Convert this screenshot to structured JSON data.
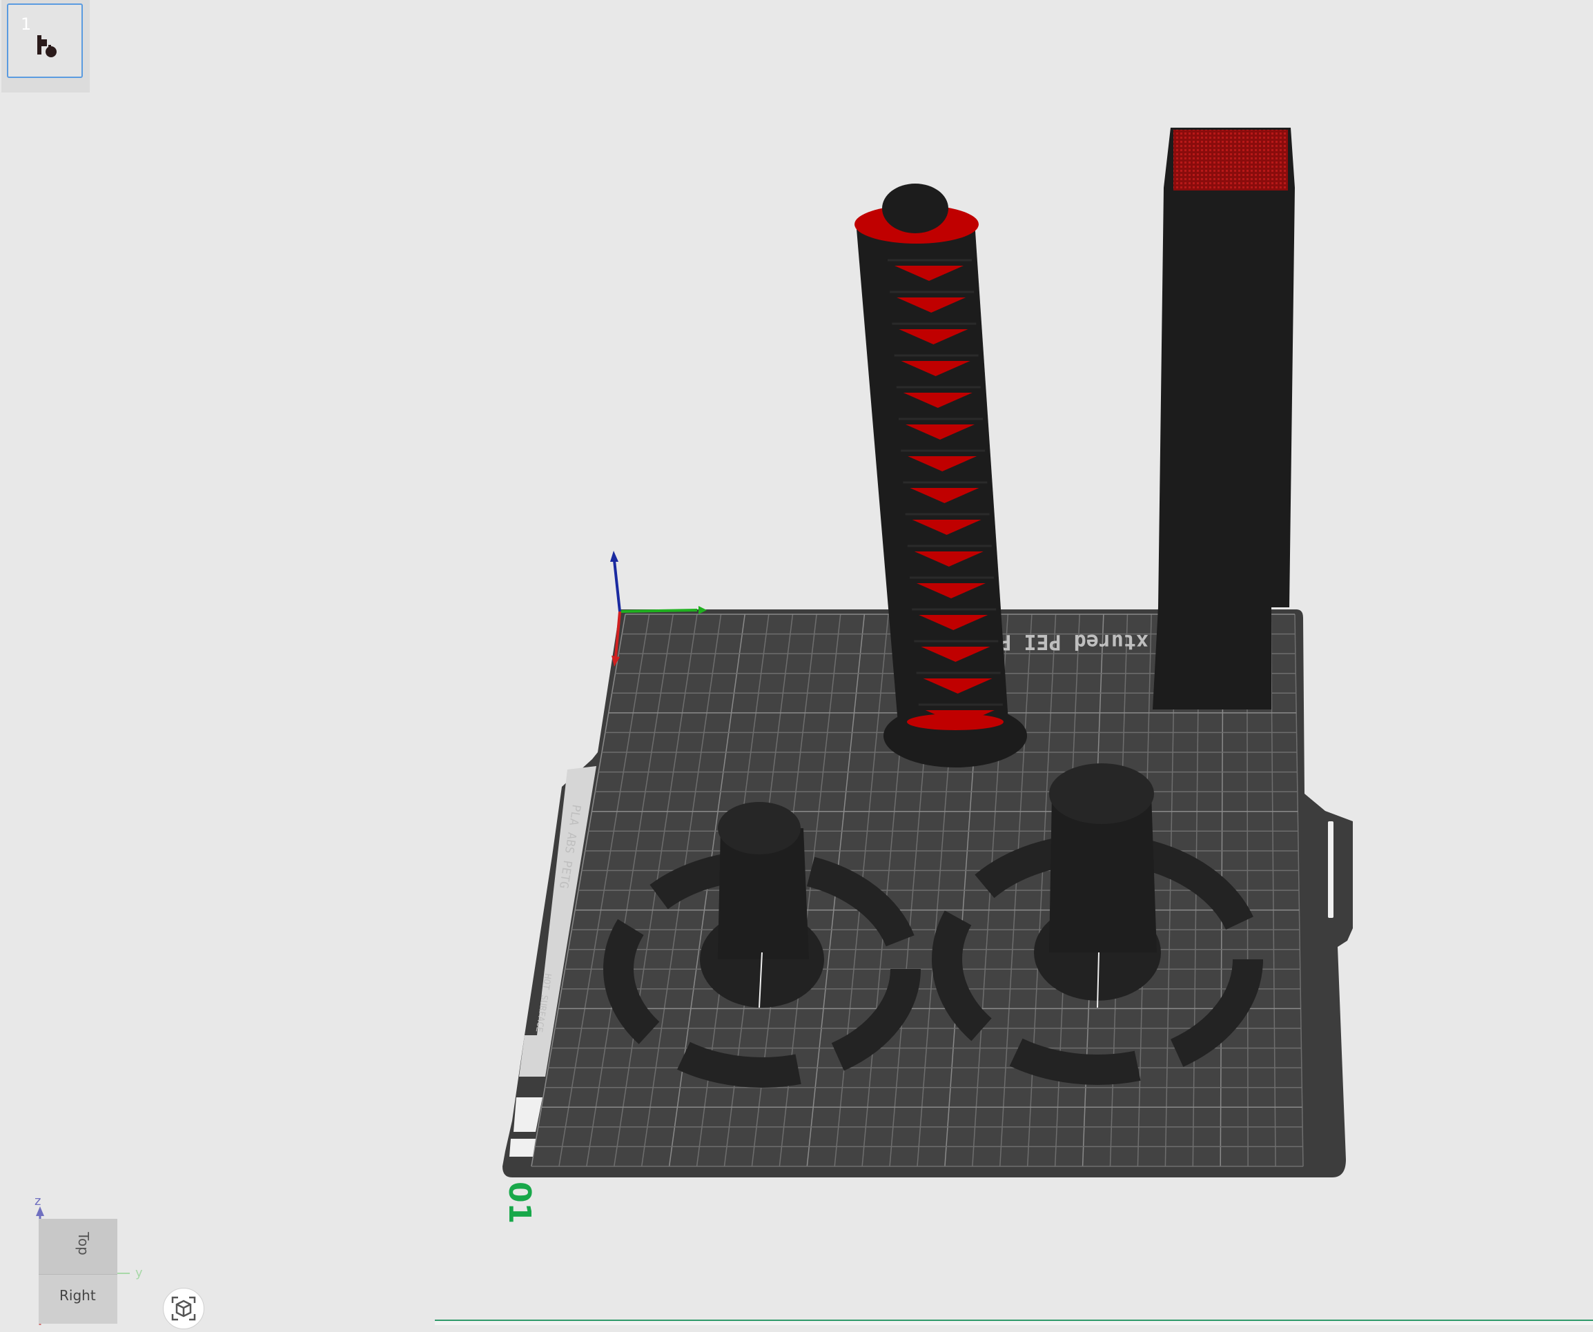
{
  "plate_list": {
    "plates": [
      {
        "number": "1",
        "selected": true
      }
    ]
  },
  "build_plate": {
    "surface_text": "xtured PEI P",
    "side_label_materials": "PLA ABS PETG",
    "side_label_warning": "HOT SURFACE",
    "plate_index_label": "01"
  },
  "view_cube": {
    "face_top": "Top",
    "face_right": "Right",
    "axis_z": "z",
    "axis_y": "y"
  },
  "colors": {
    "background": "#e8e8e8",
    "bed": "#3d3d3d",
    "grid": "#6a6a6a",
    "model": "#1c1c1c",
    "accent_red": "#c00000",
    "plate_label": "#18a84a",
    "axis_x": "#d02020",
    "axis_y": "#20b020",
    "axis_z": "#1a2aa0",
    "selection_border": "#5a9be0"
  },
  "icons": {
    "plate_thumbnail": "model-thumbnail-icon",
    "camera_reset": "view-fit-icon"
  }
}
